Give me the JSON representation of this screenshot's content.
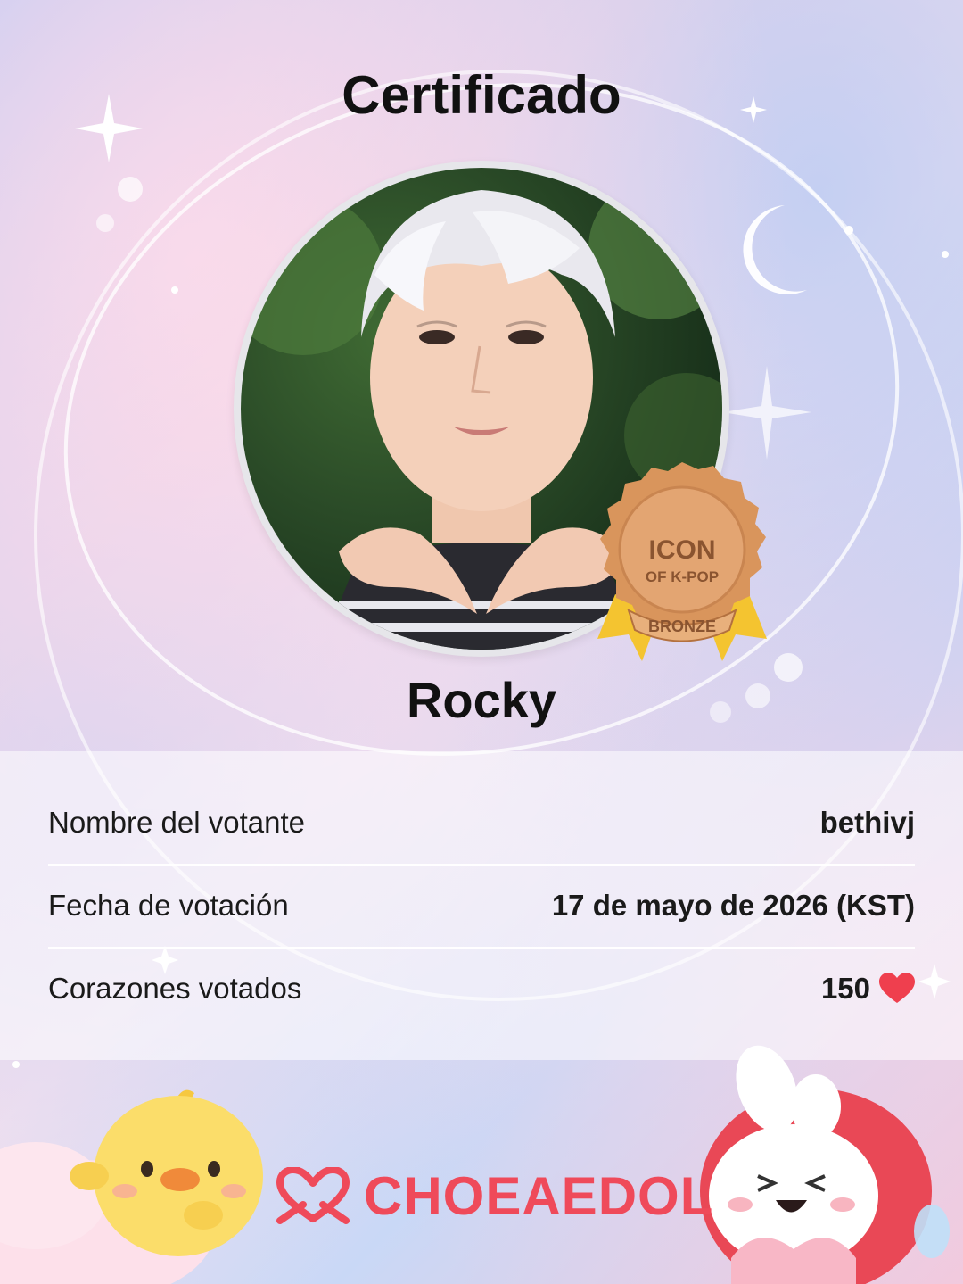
{
  "certificate": {
    "title": "Certificado",
    "idol_name": "Rocky",
    "badge": {
      "line1": "ICON",
      "line2": "OF K-POP",
      "tier": "BRONZE"
    },
    "rows": [
      {
        "label": "Nombre del votante",
        "value": "bethivj"
      },
      {
        "label": "Fecha de votación",
        "value": "17 de mayo de 2026 (KST)"
      },
      {
        "label": "Corazones votados",
        "value": "150"
      }
    ]
  },
  "footer": {
    "brand": "CHOEAEDOL"
  },
  "colors": {
    "brand": "#ef4a5a",
    "heart": "#ef3f4e",
    "bronze": "#d9955c"
  }
}
